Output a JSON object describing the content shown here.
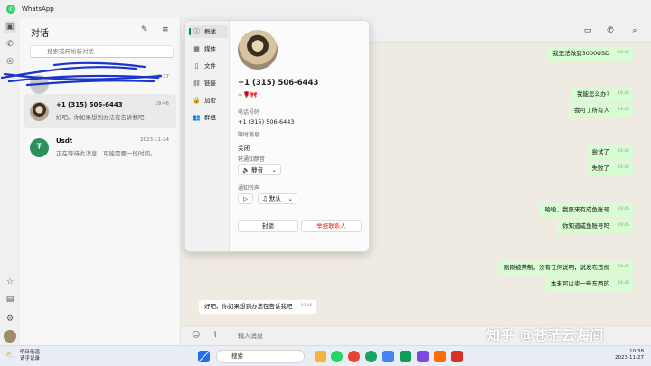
{
  "app": {
    "title": "WhatsApp"
  },
  "chatlist": {
    "title": "对话",
    "search_placeholder": "搜索或开始新对话",
    "chats": [
      {
        "name": "",
        "preview": "",
        "time": "10:37"
      },
      {
        "name": "+1 (315) 506-6443",
        "preview": "好吧。你如果想到办法在告诉我吧",
        "time": "19:46"
      },
      {
        "name": "Usdt",
        "preview": "正在等待此消息，可能需要一段时间。",
        "time": "2023-11-24"
      }
    ]
  },
  "conversation": {
    "messages": [
      {
        "text": "我无法做到3000USD",
        "time": "19:45",
        "dir": "out"
      },
      {
        "text": "我能怎么办?",
        "time": "19:45",
        "dir": "out"
      },
      {
        "text": "我可了所有人",
        "time": "19:45",
        "dir": "out"
      },
      {
        "text": "尝试了",
        "time": "19:45",
        "dir": "out"
      },
      {
        "text": "失败了",
        "time": "19:45",
        "dir": "out"
      },
      {
        "text": "哈哈，我原来有成鱼账号",
        "time": "19:45",
        "dir": "out"
      },
      {
        "text": "你知道咸鱼账号吗",
        "time": "19:45",
        "dir": "out"
      },
      {
        "text": "刚刚被禁制，没有任何说明，说发布违规",
        "time": "19:45",
        "dir": "out"
      },
      {
        "text": "本来可以卖一些东西的",
        "time": "19:46",
        "dir": "out"
      },
      {
        "text": "好吧。你如果想到办法在告诉我吧",
        "time": "19:46",
        "dir": "in"
      }
    ],
    "input_placeholder": "输入消息"
  },
  "contact_panel": {
    "nav": [
      {
        "label": "概述",
        "icon": "info-icon"
      },
      {
        "label": "媒体",
        "icon": "media-icon"
      },
      {
        "label": "文件",
        "icon": "file-icon"
      },
      {
        "label": "链接",
        "icon": "link-icon"
      },
      {
        "label": "加密",
        "icon": "lock-icon"
      },
      {
        "label": "群组",
        "icon": "group-icon"
      }
    ],
    "name": "+1 (315) 506-6443",
    "about": "~🌹🎀",
    "phone_label": "电话号码",
    "phone_value": "+1 (315) 506-6443",
    "disappearing_label": "限时消息",
    "disappearing_value": "关闭",
    "mute_label": "将通知静音",
    "mute_value": "静音",
    "tone_label": "通知铃声",
    "tone_value": "默认",
    "block_label": "封锁",
    "report_label": "举报联系人"
  },
  "watermark": "知乎 @苍茫云海间",
  "taskbar": {
    "weather_title": "明日低温",
    "weather_sub": "请乎记录",
    "search_label": "搜索",
    "time": "10:38",
    "date": "2023-11-27"
  },
  "colors": {
    "accent": "#008069",
    "outgoing_bubble": "#d9fdd3",
    "report_red": "#d93025"
  }
}
